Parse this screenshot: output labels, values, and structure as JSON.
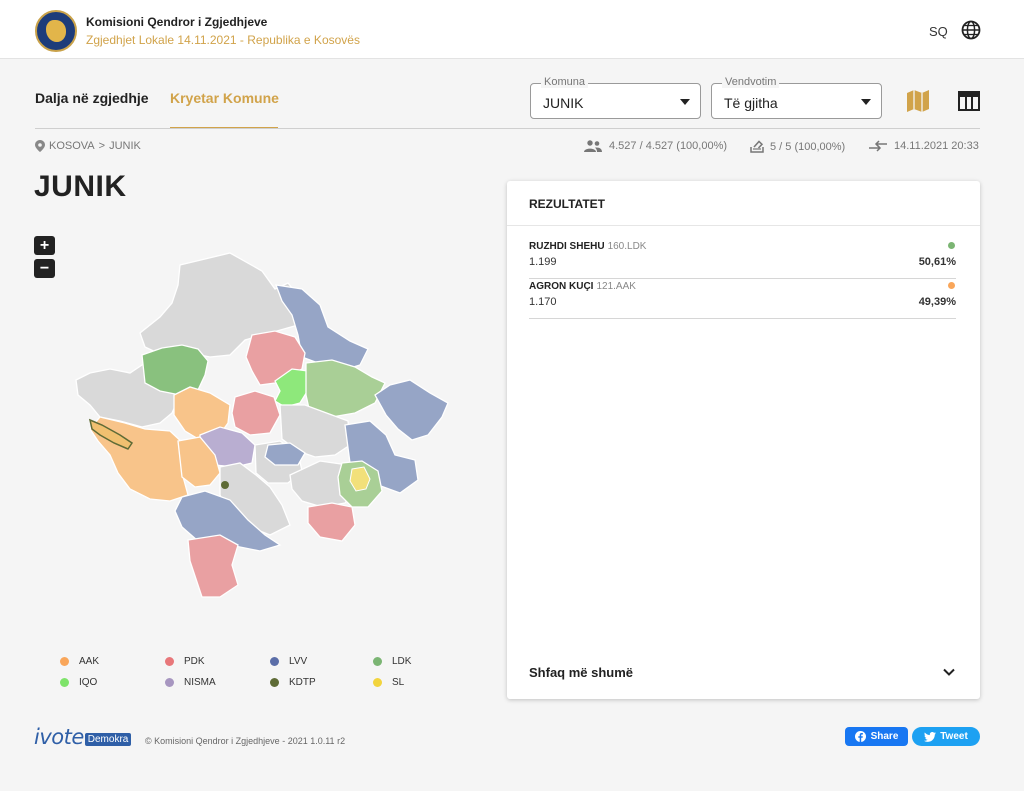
{
  "header": {
    "org_title": "Komisioni Qendror i Zgjedhjeve",
    "org_subtitle": "Zgjedhjet Lokale 14.11.2021 - Republika e Kosovës",
    "language": "SQ"
  },
  "tabs": [
    {
      "label": "Dalja në zgjedhje",
      "active": false
    },
    {
      "label": "Kryetar Komune",
      "active": true
    }
  ],
  "filters": {
    "komuna": {
      "label": "Komuna",
      "value": "JUNIK"
    },
    "vendvotim": {
      "label": "Vendvotim",
      "value": "Të gjitha"
    }
  },
  "breadcrumb": {
    "root": "KOSOVA",
    "separator": ">",
    "current": "JUNIK"
  },
  "stats": {
    "voters": "4.527 / 4.527 (100,00%)",
    "stations": "5 / 5 (100,00%)",
    "updated": "14.11.2021 20:33"
  },
  "page_title": "JUNIK",
  "map": {
    "zoom_in": "+",
    "zoom_out": "−"
  },
  "legend": [
    {
      "label": "AAK",
      "color": "#f9a65a"
    },
    {
      "label": "PDK",
      "color": "#e8777a"
    },
    {
      "label": "LVV",
      "color": "#5b6ea8"
    },
    {
      "label": "LDK",
      "color": "#7bb573"
    },
    {
      "label": "IQO",
      "color": "#7ee36a"
    },
    {
      "label": "NISMA",
      "color": "#a796c0"
    },
    {
      "label": "KDTP",
      "color": "#5e6b36"
    },
    {
      "label": "SL",
      "color": "#f2d43d"
    }
  ],
  "results": {
    "title": "REZULTATET",
    "candidates": [
      {
        "name": "RUZHDI SHEHU",
        "party": "160.LDK",
        "votes": "1.199",
        "percent": "50,61%",
        "color": "#7bb573"
      },
      {
        "name": "AGRON KUÇI",
        "party": "121.AAK",
        "votes": "1.170",
        "percent": "49,39%",
        "color": "#f9a65a"
      }
    ],
    "show_more": "Shfaq më shumë"
  },
  "footer": {
    "brand_main": "ivote",
    "brand_tag": "Demokra",
    "copyright": "© Komisioni Qendror i Zgjedhjeve - 2021 1.0.11 r2",
    "share_label": "Share",
    "tweet_label": "Tweet"
  }
}
